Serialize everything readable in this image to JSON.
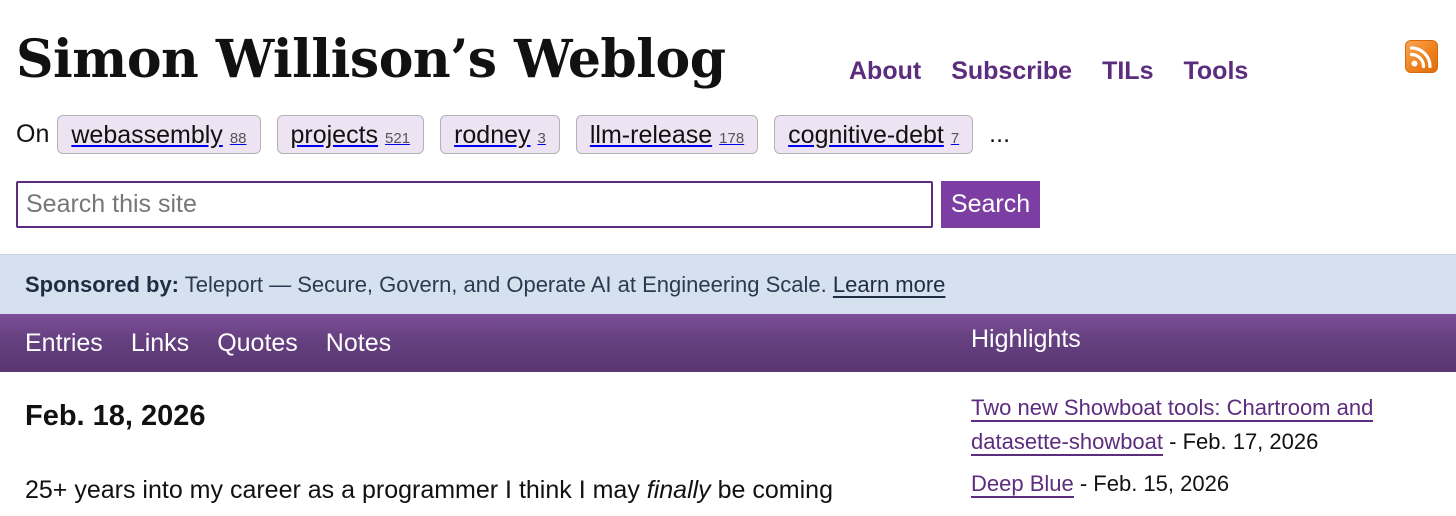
{
  "header": {
    "site_title": "Simon Willison’s Weblog",
    "nav": [
      "About",
      "Subscribe",
      "TILs",
      "Tools"
    ],
    "rss_icon": "rss-feed-icon"
  },
  "tags": {
    "prefix": "On",
    "items": [
      {
        "name": "webassembly",
        "count": "88"
      },
      {
        "name": "projects",
        "count": "521"
      },
      {
        "name": "rodney",
        "count": "3"
      },
      {
        "name": "llm-release",
        "count": "178"
      },
      {
        "name": "cognitive-debt",
        "count": "7"
      }
    ],
    "more": "..."
  },
  "search": {
    "placeholder": "Search this site",
    "value": "",
    "button_label": "Search"
  },
  "sponsor": {
    "label": "Sponsored by:",
    "text": "Teleport — Secure, Govern, and Operate AI at Engineering Scale.",
    "link": "Learn more"
  },
  "section_nav": {
    "items": [
      "Entries",
      "Links",
      "Quotes",
      "Notes"
    ],
    "highlights_heading": "Highlights"
  },
  "main": {
    "date": "Feb. 18, 2026",
    "text_before": "25+ years into my career as a programmer I think I may ",
    "text_emphasis": "finally",
    "text_after": " be coming"
  },
  "highlights": [
    {
      "title": "Two new Showboat tools: Chartroom and datasette-showboat",
      "date": " - Feb. 17, 2026"
    },
    {
      "title": "Deep Blue",
      "date": " - Feb. 15, 2026"
    }
  ],
  "colors": {
    "accent": "#5c2c7e",
    "button": "#7d3ea3",
    "tag_bg": "#ede3f2",
    "sponsor_bg": "#d5e1ee",
    "nav_bar": "#65407f",
    "rss": "#ee7f1b"
  }
}
